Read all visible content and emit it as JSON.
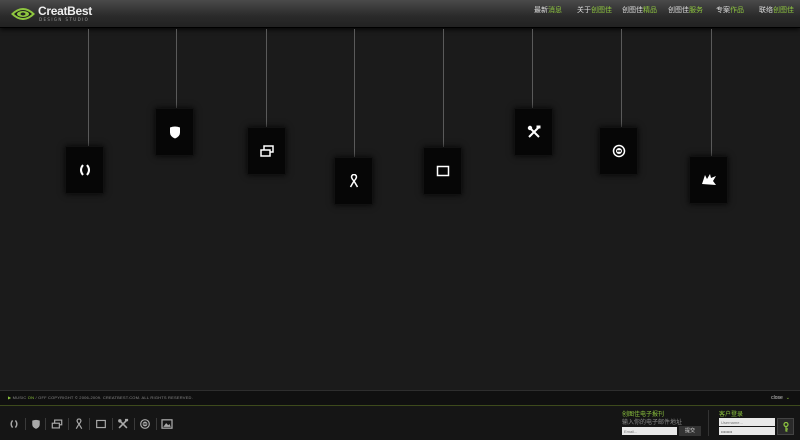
{
  "header": {
    "logo_text": "CreatBest",
    "logo_tagline": "DESIGN STUDIO",
    "nav": [
      {
        "prefix": "最新",
        "highlight": "消息"
      },
      {
        "prefix": "关于",
        "highlight": "创图佳"
      },
      {
        "prefix": "创图佳",
        "highlight": "精品"
      },
      {
        "prefix": "创图佳",
        "highlight": "服务"
      },
      {
        "prefix": "专案",
        "highlight": "作品"
      },
      {
        "prefix": "联络",
        "highlight": "创图佳"
      }
    ]
  },
  "cards": [
    {
      "icon": "code-icon"
    },
    {
      "icon": "shield-icon"
    },
    {
      "icon": "windows-icon"
    },
    {
      "icon": "ribbon-icon"
    },
    {
      "icon": "window-icon"
    },
    {
      "icon": "tools-icon"
    },
    {
      "icon": "coin-icon"
    },
    {
      "icon": "badge-icon"
    }
  ],
  "footer": {
    "music_label": "MUSIC",
    "music_on": "ON",
    "music_separator": "/",
    "music_off": "OFF",
    "copyright": "COPYRIGHT © 2006-2009. CREATBEST.COM. ALL RIGHTS RESERVED.",
    "close_label": "close",
    "dock_icons": [
      "code-icon",
      "shield-icon",
      "windows-icon",
      "ribbon-icon",
      "window-icon",
      "tools-icon",
      "coin-icon",
      "image-icon"
    ],
    "subscribe": {
      "title": "创图佳电子报刊",
      "description": "输入你的电子邮件地址",
      "email_placeholder": "Email...",
      "submit_label": "提交"
    },
    "login": {
      "title": "客户登录",
      "username_placeholder": "Username...",
      "password_value": "••••••••"
    }
  },
  "colors": {
    "accent": "#8ec63f",
    "background": "#1b1b1b",
    "card": "#060606"
  }
}
